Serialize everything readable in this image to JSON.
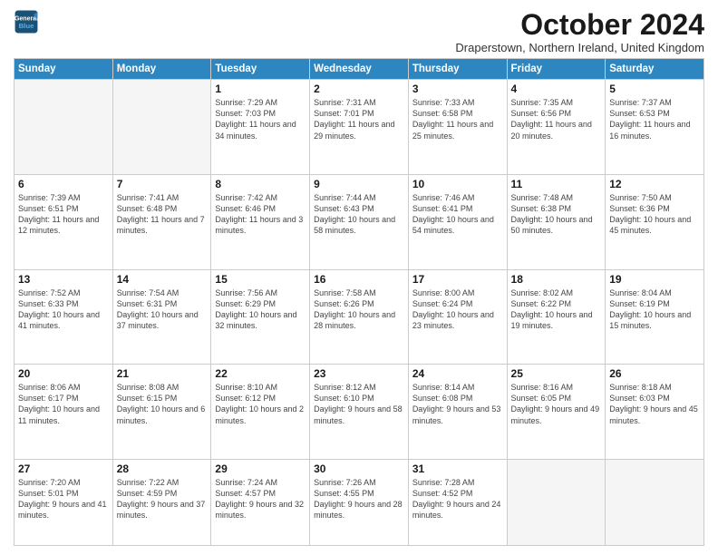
{
  "header": {
    "logo_line1": "General",
    "logo_line2": "Blue",
    "month": "October 2024",
    "location": "Draperstown, Northern Ireland, United Kingdom"
  },
  "days_of_week": [
    "Sunday",
    "Monday",
    "Tuesday",
    "Wednesday",
    "Thursday",
    "Friday",
    "Saturday"
  ],
  "weeks": [
    [
      {
        "day": "",
        "info": ""
      },
      {
        "day": "",
        "info": ""
      },
      {
        "day": "1",
        "info": "Sunrise: 7:29 AM\nSunset: 7:03 PM\nDaylight: 11 hours and 34 minutes."
      },
      {
        "day": "2",
        "info": "Sunrise: 7:31 AM\nSunset: 7:01 PM\nDaylight: 11 hours and 29 minutes."
      },
      {
        "day": "3",
        "info": "Sunrise: 7:33 AM\nSunset: 6:58 PM\nDaylight: 11 hours and 25 minutes."
      },
      {
        "day": "4",
        "info": "Sunrise: 7:35 AM\nSunset: 6:56 PM\nDaylight: 11 hours and 20 minutes."
      },
      {
        "day": "5",
        "info": "Sunrise: 7:37 AM\nSunset: 6:53 PM\nDaylight: 11 hours and 16 minutes."
      }
    ],
    [
      {
        "day": "6",
        "info": "Sunrise: 7:39 AM\nSunset: 6:51 PM\nDaylight: 11 hours and 12 minutes."
      },
      {
        "day": "7",
        "info": "Sunrise: 7:41 AM\nSunset: 6:48 PM\nDaylight: 11 hours and 7 minutes."
      },
      {
        "day": "8",
        "info": "Sunrise: 7:42 AM\nSunset: 6:46 PM\nDaylight: 11 hours and 3 minutes."
      },
      {
        "day": "9",
        "info": "Sunrise: 7:44 AM\nSunset: 6:43 PM\nDaylight: 10 hours and 58 minutes."
      },
      {
        "day": "10",
        "info": "Sunrise: 7:46 AM\nSunset: 6:41 PM\nDaylight: 10 hours and 54 minutes."
      },
      {
        "day": "11",
        "info": "Sunrise: 7:48 AM\nSunset: 6:38 PM\nDaylight: 10 hours and 50 minutes."
      },
      {
        "day": "12",
        "info": "Sunrise: 7:50 AM\nSunset: 6:36 PM\nDaylight: 10 hours and 45 minutes."
      }
    ],
    [
      {
        "day": "13",
        "info": "Sunrise: 7:52 AM\nSunset: 6:33 PM\nDaylight: 10 hours and 41 minutes."
      },
      {
        "day": "14",
        "info": "Sunrise: 7:54 AM\nSunset: 6:31 PM\nDaylight: 10 hours and 37 minutes."
      },
      {
        "day": "15",
        "info": "Sunrise: 7:56 AM\nSunset: 6:29 PM\nDaylight: 10 hours and 32 minutes."
      },
      {
        "day": "16",
        "info": "Sunrise: 7:58 AM\nSunset: 6:26 PM\nDaylight: 10 hours and 28 minutes."
      },
      {
        "day": "17",
        "info": "Sunrise: 8:00 AM\nSunset: 6:24 PM\nDaylight: 10 hours and 23 minutes."
      },
      {
        "day": "18",
        "info": "Sunrise: 8:02 AM\nSunset: 6:22 PM\nDaylight: 10 hours and 19 minutes."
      },
      {
        "day": "19",
        "info": "Sunrise: 8:04 AM\nSunset: 6:19 PM\nDaylight: 10 hours and 15 minutes."
      }
    ],
    [
      {
        "day": "20",
        "info": "Sunrise: 8:06 AM\nSunset: 6:17 PM\nDaylight: 10 hours and 11 minutes."
      },
      {
        "day": "21",
        "info": "Sunrise: 8:08 AM\nSunset: 6:15 PM\nDaylight: 10 hours and 6 minutes."
      },
      {
        "day": "22",
        "info": "Sunrise: 8:10 AM\nSunset: 6:12 PM\nDaylight: 10 hours and 2 minutes."
      },
      {
        "day": "23",
        "info": "Sunrise: 8:12 AM\nSunset: 6:10 PM\nDaylight: 9 hours and 58 minutes."
      },
      {
        "day": "24",
        "info": "Sunrise: 8:14 AM\nSunset: 6:08 PM\nDaylight: 9 hours and 53 minutes."
      },
      {
        "day": "25",
        "info": "Sunrise: 8:16 AM\nSunset: 6:05 PM\nDaylight: 9 hours and 49 minutes."
      },
      {
        "day": "26",
        "info": "Sunrise: 8:18 AM\nSunset: 6:03 PM\nDaylight: 9 hours and 45 minutes."
      }
    ],
    [
      {
        "day": "27",
        "info": "Sunrise: 7:20 AM\nSunset: 5:01 PM\nDaylight: 9 hours and 41 minutes."
      },
      {
        "day": "28",
        "info": "Sunrise: 7:22 AM\nSunset: 4:59 PM\nDaylight: 9 hours and 37 minutes."
      },
      {
        "day": "29",
        "info": "Sunrise: 7:24 AM\nSunset: 4:57 PM\nDaylight: 9 hours and 32 minutes."
      },
      {
        "day": "30",
        "info": "Sunrise: 7:26 AM\nSunset: 4:55 PM\nDaylight: 9 hours and 28 minutes."
      },
      {
        "day": "31",
        "info": "Sunrise: 7:28 AM\nSunset: 4:52 PM\nDaylight: 9 hours and 24 minutes."
      },
      {
        "day": "",
        "info": ""
      },
      {
        "day": "",
        "info": ""
      }
    ]
  ]
}
